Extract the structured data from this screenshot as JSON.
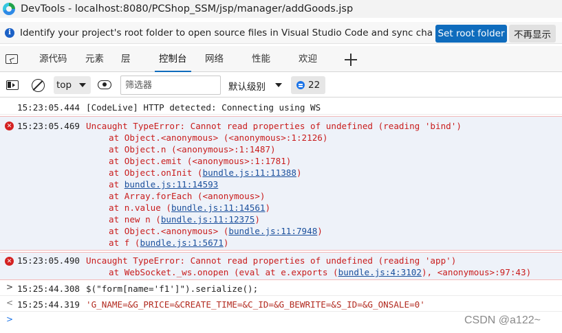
{
  "window": {
    "title": "DevTools - localhost:8080/PCShop_SSM/jsp/manager/addGoods.jsp"
  },
  "infobar": {
    "message": "Identify your project's root folder to open source files in Visual Studio Code and sync changes.",
    "primary_button": "Set root folder",
    "secondary_button": "不再显示"
  },
  "tabs": [
    {
      "label": "源代码"
    },
    {
      "label": "元素"
    },
    {
      "label": "层"
    },
    {
      "label": "控制台",
      "active": true
    },
    {
      "label": "网络"
    },
    {
      "label": "性能"
    },
    {
      "label": "欢迎"
    }
  ],
  "toolbar": {
    "context": "top",
    "filter_placeholder": "筛选器",
    "level": "默认级别",
    "issues_count": "22"
  },
  "console": {
    "info1": {
      "time": "15:23:05.444",
      "text": "[CodeLive] HTTP detected: Connecting using WS"
    },
    "error1": {
      "time": "15:23:05.469",
      "message": "Uncaught TypeError: Cannot read properties of undefined (reading 'bind')",
      "frames": [
        {
          "pre": "at Object.<anonymous> (<anonymous>:1:2126)"
        },
        {
          "pre": "at Object.n (<anonymous>:1:1487)"
        },
        {
          "pre": "at Object.emit (<anonymous>:1:1781)"
        },
        {
          "pre": "at Object.onInit (",
          "link": "bundle.js:11:11388",
          "post": ")"
        },
        {
          "pre": "at ",
          "link": "bundle.js:11:14593",
          "post": ""
        },
        {
          "pre": "at Array.forEach (<anonymous>)"
        },
        {
          "pre": "at n.value (",
          "link": "bundle.js:11:14561",
          "post": ")"
        },
        {
          "pre": "at new n (",
          "link": "bundle.js:11:12375",
          "post": ")"
        },
        {
          "pre": "at Object.<anonymous> (",
          "link": "bundle.js:11:7948",
          "post": ")"
        },
        {
          "pre": "at f (",
          "link": "bundle.js:1:5671",
          "post": ")"
        }
      ]
    },
    "error2": {
      "time": "15:23:05.490",
      "message": "Uncaught TypeError: Cannot read properties of undefined (reading 'app')",
      "frame_pre": "at WebSocket._ws.onopen (eval at e.exports (",
      "frame_link": "bundle.js:4:3102",
      "frame_post": "), <anonymous>:97:43)"
    },
    "input1": {
      "time": "15:25:44.308",
      "code": "$(\"form[name='f1']\").serialize();"
    },
    "output1": {
      "time": "15:25:44.319",
      "value": "'G_NAME=&G_PRICE=&CREATE_TIME=&C_ID=&G_BEWRITE=&S_ID=&G_ONSALE=0'"
    }
  },
  "watermark": "CSDN @a122~"
}
